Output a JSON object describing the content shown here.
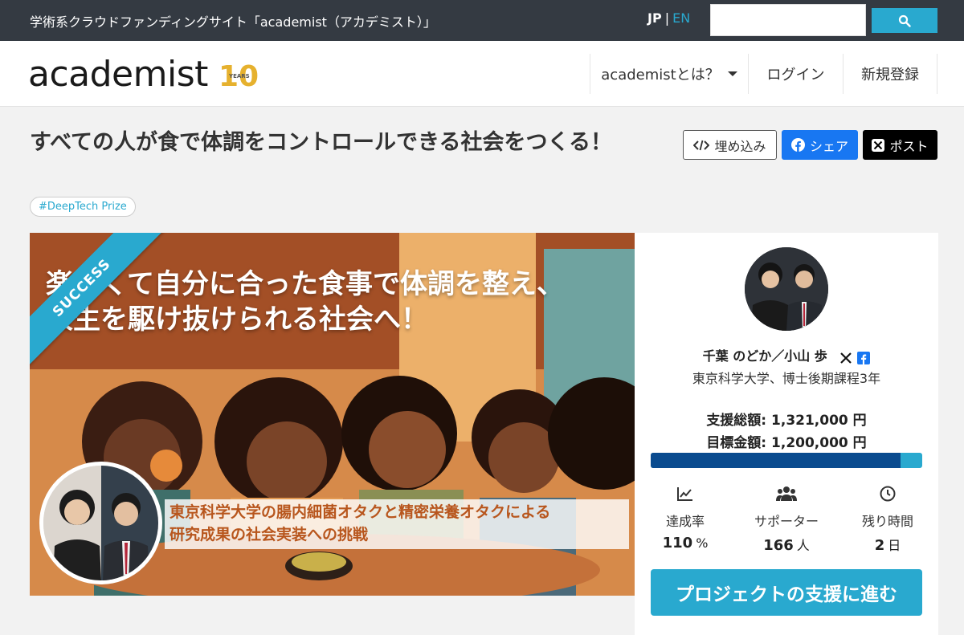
{
  "topbar": {
    "tagline": "学術系クラウドファンディングサイト「academist（アカデミスト）」",
    "lang_jp": "JP",
    "lang_sep": "|",
    "lang_en": "EN",
    "search_value": "",
    "search_icon": "search-icon"
  },
  "header": {
    "logo_text": "academist",
    "logo_badge_number": "10",
    "logo_badge_text": "YEARS",
    "nav_about": "academistとは？",
    "nav_login": "ログイン",
    "nav_signup": "新規登録"
  },
  "project": {
    "title": "すべての人が食で体調をコントロールできる社会をつくる！",
    "tag": "#DeepTech Prize",
    "embed_label": "埋め込み",
    "share_label": "シェア",
    "post_label": "ポスト"
  },
  "hero": {
    "ribbon": "SUCCESS",
    "line1": "楽しくて自分に合った食事で体調を整え、",
    "line2": "人生を駆け抜けられる社会へ！",
    "caption1": "東京科学大学の腸内細菌オタクと精密栄養オタクによる",
    "caption2": "研究成果の社会実装への挑戦"
  },
  "card": {
    "researcher": "千葉 のどか／小山 歩",
    "affiliation": "東京科学大学、博士後期課程3年",
    "total_label": "支援総額: 1,321,000 円",
    "goal_label": "目標金額: 1,200,000 円",
    "progress_fraction": 0.92,
    "stats": [
      {
        "label": "達成率",
        "value": "110",
        "unit": "%",
        "icon": "chart-line-icon"
      },
      {
        "label": "サポーター",
        "value": "166",
        "unit": "人",
        "icon": "users-icon"
      },
      {
        "label": "残り時間",
        "value": "2",
        "unit": "日",
        "icon": "clock-icon"
      }
    ],
    "cta": "プロジェクトの支援に進む"
  },
  "colors": {
    "accent": "#29a9cf",
    "topbar": "#343a42",
    "progress_fill": "#0a4b8f",
    "facebook": "#1877f2",
    "x": "#000000"
  }
}
